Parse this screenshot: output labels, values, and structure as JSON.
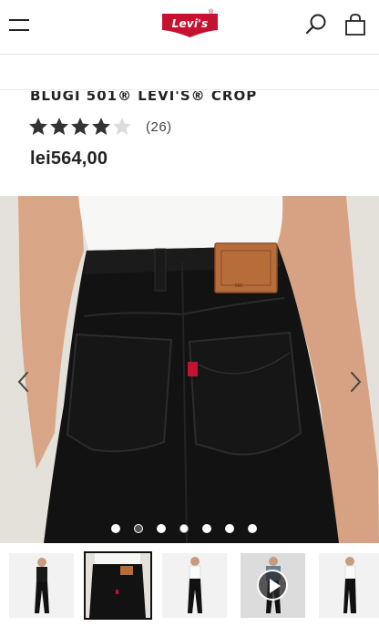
{
  "header": {
    "menu_icon": "hamburger-menu-icon",
    "brand": "Levi's",
    "brand_reg": "®",
    "search_icon": "search-icon",
    "bag_icon": "shopping-bag-icon",
    "brand_color": "#c41230"
  },
  "product": {
    "title": "BLUGI 501® LEVI'S® CROP",
    "rating_stars": 4,
    "rating_max": 5,
    "review_count": "(26)",
    "price": "lei564,00"
  },
  "gallery": {
    "prev_icon": "chevron-left-icon",
    "next_icon": "chevron-right-icon",
    "slide_count": 7,
    "active_slide": 2,
    "label_text": "501"
  },
  "thumbnails": [
    {
      "view": "front"
    },
    {
      "view": "back-detail",
      "selected": true
    },
    {
      "view": "front-waist"
    },
    {
      "view": "video",
      "video": true
    },
    {
      "view": "side"
    }
  ]
}
